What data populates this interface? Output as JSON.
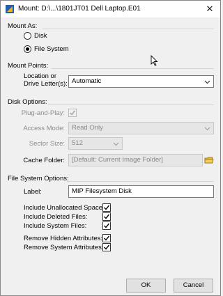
{
  "window": {
    "title": "Mount: D:\\...\\1801JT01 Dell Laptop.E01",
    "close_glyph": "✕"
  },
  "mount_as": {
    "group_label": "Mount As:",
    "options": [
      {
        "label": "Disk",
        "selected": false
      },
      {
        "label": "File System",
        "selected": true
      }
    ]
  },
  "mount_points": {
    "group_label": "Mount Points:",
    "location_label_line1": "Location or",
    "location_label_line2": "Drive Letter(s):",
    "location_value": "Automatic"
  },
  "disk_options": {
    "group_label": "Disk Options:",
    "plug_and_play_label": "Plug-and-Play:",
    "plug_and_play_checked": true,
    "access_mode_label": "Access Mode:",
    "access_mode_value": "Read Only",
    "sector_size_label": "Sector Size:",
    "sector_size_value": "512",
    "cache_folder_label": "Cache Folder:",
    "cache_folder_placeholder": "[Default: Current Image Folder]"
  },
  "fs_options": {
    "group_label": "File System Options:",
    "label_label": "Label:",
    "label_value": "MIP Filesystem Disk",
    "include_unallocated_label": "Include Unallocated Space:",
    "include_deleted_label": "Include Deleted Files:",
    "include_system_label": "Include System Files:",
    "remove_hidden_label": "Remove Hidden Attributes:",
    "remove_system_attr_label": "Remove System Attributes:",
    "checks": {
      "include_unallocated": true,
      "include_deleted": true,
      "include_system": true,
      "remove_hidden": true,
      "remove_system_attr": true
    }
  },
  "buttons": {
    "ok": "OK",
    "cancel": "Cancel"
  },
  "colors": {
    "accent": "#0b63c5",
    "folder": "#e8b93c"
  }
}
